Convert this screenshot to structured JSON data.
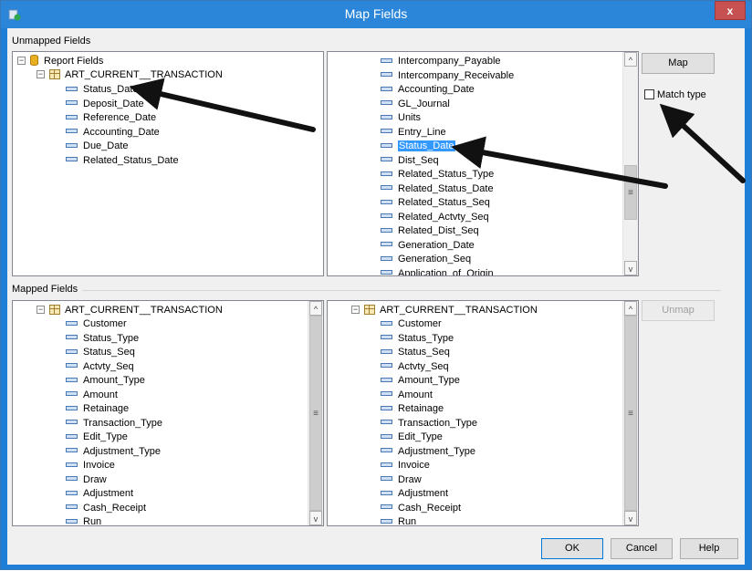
{
  "window": {
    "title": "Map Fields",
    "close_label": "x"
  },
  "unmapped": {
    "label": "Unmapped Fields",
    "left_tree": {
      "root": "Report Fields",
      "table": "ART_CURRENT__TRANSACTION",
      "fields": [
        "Status_Date",
        "Deposit_Date",
        "Reference_Date",
        "Accounting_Date",
        "Due_Date",
        "Related_Status_Date"
      ]
    },
    "right_list": [
      "Intercompany_Payable",
      "Intercompany_Receivable",
      "Accounting_Date",
      "GL_Journal",
      "Units",
      "Entry_Line",
      "Status_Date",
      "Dist_Seq",
      "Related_Status_Type",
      "Related_Status_Date",
      "Related_Status_Seq",
      "Related_Actvty_Seq",
      "Related_Dist_Seq",
      "Generation_Date",
      "Generation_Seq",
      "Application_of_Origin"
    ],
    "right_selected_index": 6,
    "map_button": "Map",
    "match_type_label": "Match type",
    "match_type_checked": false
  },
  "mapped": {
    "label": "Mapped Fields",
    "left_table": "ART_CURRENT__TRANSACTION",
    "left_fields": [
      "Customer",
      "Status_Type",
      "Status_Seq",
      "Actvty_Seq",
      "Amount_Type",
      "Amount",
      "Retainage",
      "Transaction_Type",
      "Edit_Type",
      "Adjustment_Type",
      "Invoice",
      "Draw",
      "Adjustment",
      "Cash_Receipt",
      "Run"
    ],
    "right_table": "ART_CURRENT__TRANSACTION",
    "right_fields": [
      "Customer",
      "Status_Type",
      "Status_Seq",
      "Actvty_Seq",
      "Amount_Type",
      "Amount",
      "Retainage",
      "Transaction_Type",
      "Edit_Type",
      "Adjustment_Type",
      "Invoice",
      "Draw",
      "Adjustment",
      "Cash_Receipt",
      "Run"
    ],
    "unmap_button": "Unmap"
  },
  "footer": {
    "ok": "OK",
    "cancel": "Cancel",
    "help": "Help"
  },
  "colors": {
    "title_bar": "#2b86da",
    "selection": "#3399ff",
    "close": "#c75050"
  },
  "icons": [
    "app-icon",
    "database-icon",
    "table-icon",
    "field-icon",
    "close-icon",
    "arrow-annotation"
  ]
}
